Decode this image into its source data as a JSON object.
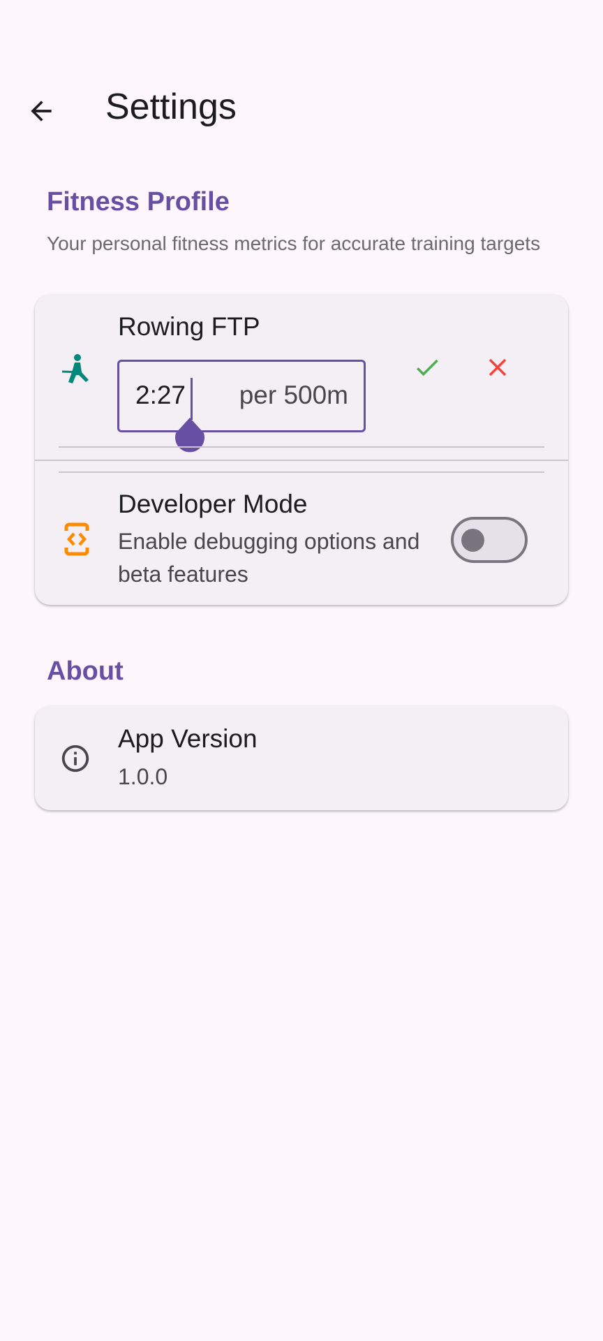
{
  "header": {
    "back_icon": "arrow-left-icon",
    "title": "Settings"
  },
  "fitness_section": {
    "title": "Fitness Profile",
    "description": "Your personal fitness metrics for accurate training targets"
  },
  "rowing_ftp": {
    "icon": "rowing-icon",
    "title": "Rowing FTP",
    "value": "2:27",
    "suffix": "per 500m",
    "confirm_icon": "check-icon",
    "cancel_icon": "close-icon"
  },
  "developer_mode": {
    "icon": "code-icon",
    "title": "Developer Mode",
    "subtitle": "Enable debugging options and beta features",
    "enabled": false
  },
  "about_section": {
    "title": "About"
  },
  "app_version": {
    "icon": "info-icon",
    "title": "App Version",
    "value": "1.0.0"
  },
  "colors": {
    "background": "#FDF7FD",
    "accent": "#6750A4",
    "card": "#F4EFF4",
    "rowing_icon": "#00897B",
    "code_icon": "#FB8C00",
    "confirm": "#4CAF50",
    "cancel": "#F44336"
  }
}
